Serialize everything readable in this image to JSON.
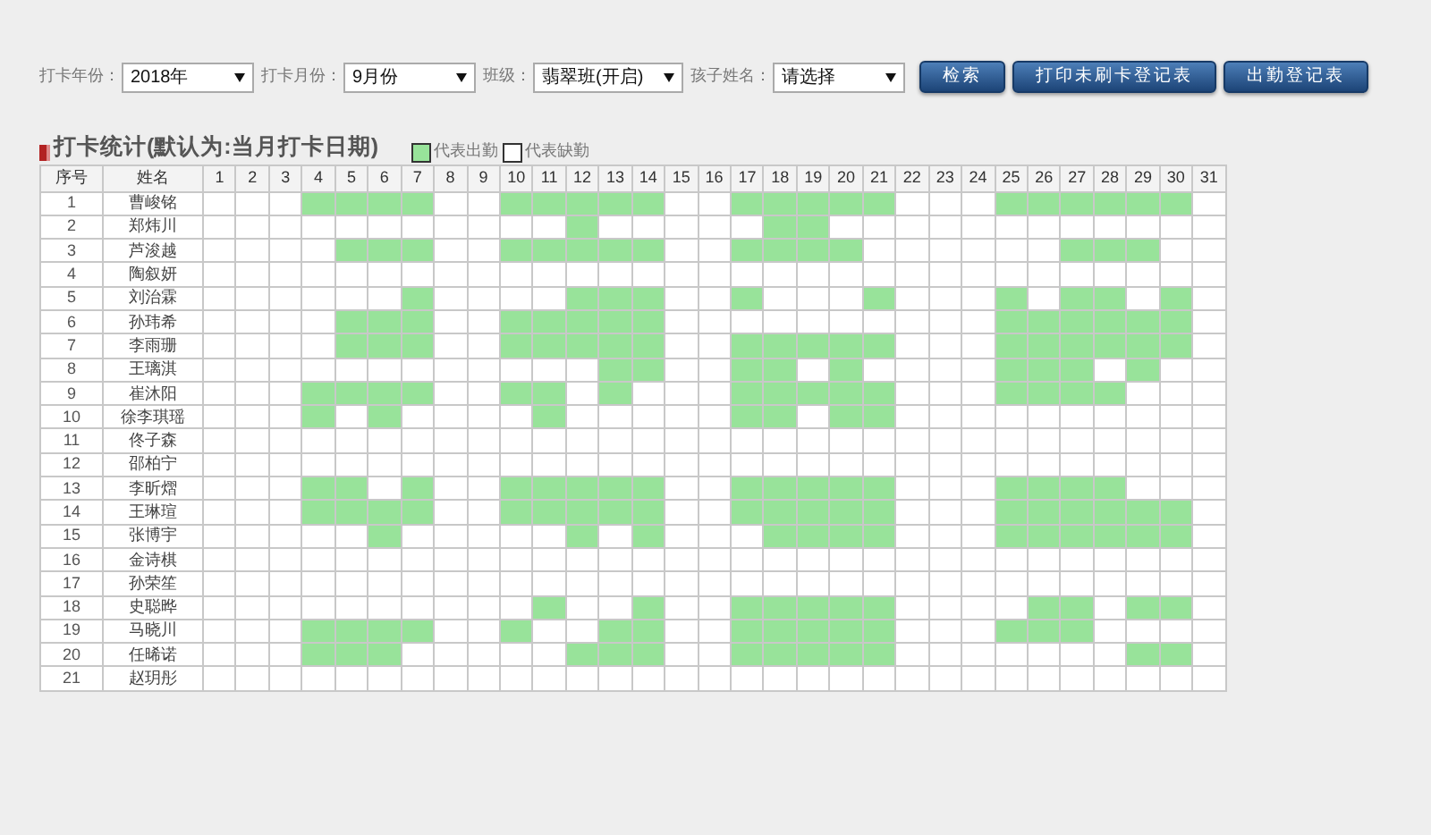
{
  "filters": [
    {
      "label": "打卡年份：",
      "value": "2018年"
    },
    {
      "label": "打卡月份：",
      "value": "9月份"
    },
    {
      "label": "班级：",
      "value": "翡翠班(开启)"
    },
    {
      "label": "孩子姓名：",
      "value": "请选择"
    }
  ],
  "buttons": [
    "检索",
    "打印未刷卡登记表",
    "出勤登记表"
  ],
  "section": {
    "title": "打卡统计(默认为:当月打卡日期)",
    "legend": [
      {
        "kind": "present",
        "label": "代表出勤"
      },
      {
        "kind": "absent",
        "label": "代表缺勤"
      }
    ]
  },
  "table": {
    "columns": [
      "序号",
      "姓名",
      "1",
      "2",
      "3",
      "4",
      "5",
      "6",
      "7",
      "8",
      "9",
      "10",
      "11",
      "12",
      "13",
      "14",
      "15",
      "16",
      "17",
      "18",
      "19",
      "20",
      "21",
      "22",
      "23",
      "24",
      "25",
      "26",
      "27",
      "28",
      "29",
      "30",
      "31"
    ],
    "rows": [
      {
        "no": "1",
        "name": "曹峻铭",
        "present": [
          false,
          false,
          false,
          true,
          true,
          true,
          true,
          false,
          false,
          true,
          true,
          true,
          true,
          true,
          false,
          false,
          true,
          true,
          true,
          true,
          true,
          false,
          false,
          false,
          true,
          true,
          true,
          true,
          true,
          true,
          false
        ]
      },
      {
        "no": "2",
        "name": "郑炜川",
        "present": [
          false,
          false,
          false,
          false,
          false,
          false,
          false,
          false,
          false,
          false,
          false,
          true,
          false,
          false,
          false,
          false,
          false,
          true,
          true,
          false,
          false,
          false,
          false,
          false,
          false,
          false,
          false,
          false,
          false,
          false,
          false
        ]
      },
      {
        "no": "3",
        "name": "芦浚越",
        "present": [
          false,
          false,
          false,
          false,
          true,
          true,
          true,
          false,
          false,
          true,
          true,
          true,
          true,
          true,
          false,
          false,
          true,
          true,
          true,
          true,
          false,
          false,
          false,
          false,
          false,
          false,
          true,
          true,
          true,
          false,
          false
        ]
      },
      {
        "no": "4",
        "name": "陶叙妍",
        "present": [
          false,
          false,
          false,
          false,
          false,
          false,
          false,
          false,
          false,
          false,
          false,
          false,
          false,
          false,
          false,
          false,
          false,
          false,
          false,
          false,
          false,
          false,
          false,
          false,
          false,
          false,
          false,
          false,
          false,
          false,
          false
        ]
      },
      {
        "no": "5",
        "name": "刘治霖",
        "present": [
          false,
          false,
          false,
          false,
          false,
          false,
          true,
          false,
          false,
          false,
          false,
          true,
          true,
          true,
          false,
          false,
          true,
          false,
          false,
          false,
          true,
          false,
          false,
          false,
          true,
          false,
          true,
          true,
          false,
          true,
          false
        ]
      },
      {
        "no": "6",
        "name": "孙玮希",
        "present": [
          false,
          false,
          false,
          false,
          true,
          true,
          true,
          false,
          false,
          true,
          true,
          true,
          true,
          true,
          false,
          false,
          false,
          false,
          false,
          false,
          false,
          false,
          false,
          false,
          true,
          true,
          true,
          true,
          true,
          true,
          false
        ]
      },
      {
        "no": "7",
        "name": "李雨珊",
        "present": [
          false,
          false,
          false,
          false,
          true,
          true,
          true,
          false,
          false,
          true,
          true,
          true,
          true,
          true,
          false,
          false,
          true,
          true,
          true,
          true,
          true,
          false,
          false,
          false,
          true,
          true,
          true,
          true,
          true,
          true,
          false
        ]
      },
      {
        "no": "8",
        "name": "王璃淇",
        "present": [
          false,
          false,
          false,
          false,
          false,
          false,
          false,
          false,
          false,
          false,
          false,
          false,
          true,
          true,
          false,
          false,
          true,
          true,
          false,
          true,
          false,
          false,
          false,
          false,
          true,
          true,
          true,
          false,
          true,
          false,
          false
        ]
      },
      {
        "no": "9",
        "name": "崔沐阳",
        "present": [
          false,
          false,
          false,
          true,
          true,
          true,
          true,
          false,
          false,
          true,
          true,
          false,
          true,
          false,
          false,
          false,
          true,
          true,
          true,
          true,
          true,
          false,
          false,
          false,
          true,
          true,
          true,
          true,
          false,
          false,
          false
        ]
      },
      {
        "no": "10",
        "name": "徐李琪瑶",
        "present": [
          false,
          false,
          false,
          true,
          false,
          true,
          false,
          false,
          false,
          false,
          true,
          false,
          false,
          false,
          false,
          false,
          true,
          true,
          false,
          true,
          true,
          false,
          false,
          false,
          false,
          false,
          false,
          false,
          false,
          false,
          false
        ]
      },
      {
        "no": "11",
        "name": "佟子森",
        "present": [
          false,
          false,
          false,
          false,
          false,
          false,
          false,
          false,
          false,
          false,
          false,
          false,
          false,
          false,
          false,
          false,
          false,
          false,
          false,
          false,
          false,
          false,
          false,
          false,
          false,
          false,
          false,
          false,
          false,
          false,
          false
        ]
      },
      {
        "no": "12",
        "name": "邵柏宁",
        "present": [
          false,
          false,
          false,
          false,
          false,
          false,
          false,
          false,
          false,
          false,
          false,
          false,
          false,
          false,
          false,
          false,
          false,
          false,
          false,
          false,
          false,
          false,
          false,
          false,
          false,
          false,
          false,
          false,
          false,
          false,
          false
        ]
      },
      {
        "no": "13",
        "name": "李昕熠",
        "present": [
          false,
          false,
          false,
          true,
          true,
          false,
          true,
          false,
          false,
          true,
          true,
          true,
          true,
          true,
          false,
          false,
          true,
          true,
          true,
          true,
          true,
          false,
          false,
          false,
          true,
          true,
          true,
          true,
          false,
          false,
          false
        ]
      },
      {
        "no": "14",
        "name": "王琳瑄",
        "present": [
          false,
          false,
          false,
          true,
          true,
          true,
          true,
          false,
          false,
          true,
          true,
          true,
          true,
          true,
          false,
          false,
          true,
          true,
          true,
          true,
          true,
          false,
          false,
          false,
          true,
          true,
          true,
          true,
          true,
          true,
          false
        ]
      },
      {
        "no": "15",
        "name": "张博宇",
        "present": [
          false,
          false,
          false,
          false,
          false,
          true,
          false,
          false,
          false,
          false,
          false,
          true,
          false,
          true,
          false,
          false,
          false,
          true,
          true,
          true,
          true,
          false,
          false,
          false,
          true,
          true,
          true,
          true,
          true,
          true,
          false
        ]
      },
      {
        "no": "16",
        "name": "金诗棋",
        "present": [
          false,
          false,
          false,
          false,
          false,
          false,
          false,
          false,
          false,
          false,
          false,
          false,
          false,
          false,
          false,
          false,
          false,
          false,
          false,
          false,
          false,
          false,
          false,
          false,
          false,
          false,
          false,
          false,
          false,
          false,
          false
        ]
      },
      {
        "no": "17",
        "name": "孙荣笙",
        "present": [
          false,
          false,
          false,
          false,
          false,
          false,
          false,
          false,
          false,
          false,
          false,
          false,
          false,
          false,
          false,
          false,
          false,
          false,
          false,
          false,
          false,
          false,
          false,
          false,
          false,
          false,
          false,
          false,
          false,
          false,
          false
        ]
      },
      {
        "no": "18",
        "name": "史聪晔",
        "present": [
          false,
          false,
          false,
          false,
          false,
          false,
          false,
          false,
          false,
          false,
          true,
          false,
          false,
          true,
          false,
          false,
          true,
          true,
          true,
          true,
          true,
          false,
          false,
          false,
          false,
          true,
          true,
          false,
          true,
          true,
          false
        ]
      },
      {
        "no": "19",
        "name": "马晓川",
        "present": [
          false,
          false,
          false,
          true,
          true,
          true,
          true,
          false,
          false,
          true,
          false,
          false,
          true,
          true,
          false,
          false,
          true,
          true,
          true,
          true,
          true,
          false,
          false,
          false,
          true,
          true,
          true,
          false,
          false,
          false,
          false
        ]
      },
      {
        "no": "20",
        "name": "任晞诺",
        "present": [
          false,
          false,
          false,
          true,
          true,
          true,
          false,
          false,
          false,
          false,
          false,
          true,
          true,
          true,
          false,
          false,
          true,
          true,
          true,
          true,
          true,
          false,
          false,
          false,
          false,
          false,
          false,
          false,
          true,
          true,
          false
        ]
      },
      {
        "no": "21",
        "name": "赵玥彤",
        "present": [
          false,
          false,
          false,
          false,
          false,
          false,
          false,
          false,
          false,
          false,
          false,
          false,
          false,
          false,
          false,
          false,
          false,
          false,
          false,
          false,
          false,
          false,
          false,
          false,
          false,
          false,
          false,
          false,
          false,
          false,
          false
        ]
      }
    ]
  }
}
